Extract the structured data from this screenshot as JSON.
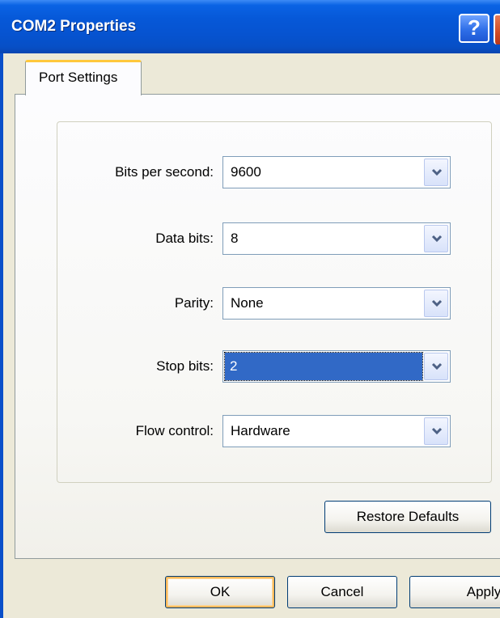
{
  "window": {
    "title": "COM2 Properties",
    "help_label": "?"
  },
  "tabs": [
    {
      "label": "Port Settings",
      "active": true
    }
  ],
  "fields": [
    {
      "label": "Bits per second:",
      "value": "9600"
    },
    {
      "label": "Data bits:",
      "value": "8"
    },
    {
      "label": "Parity:",
      "value": "None"
    },
    {
      "label": "Stop bits:",
      "value": "2",
      "focused": true
    },
    {
      "label": "Flow control:",
      "value": "Hardware"
    }
  ],
  "buttons": {
    "restore_defaults": "Restore Defaults",
    "ok": "OK",
    "cancel": "Cancel",
    "apply": "Apply"
  },
  "colors": {
    "titlebar_blue": "#0658d8",
    "selection_blue": "#3169c6",
    "dialog_bg": "#ece9d8",
    "tab_highlight": "#ffc83c",
    "default_button_glow": "#f9b95b"
  },
  "icons": {
    "help": "help-icon",
    "close": "close-icon",
    "dropdown": "chevron-down-icon"
  }
}
